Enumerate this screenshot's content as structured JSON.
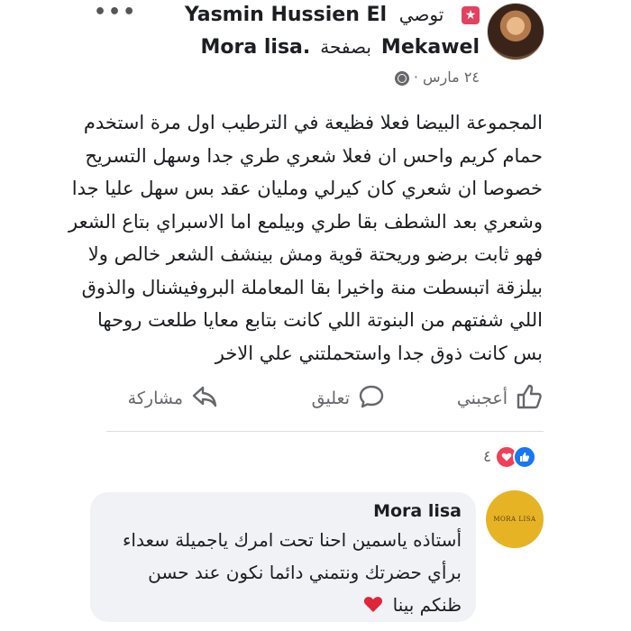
{
  "post": {
    "more_label": "•••",
    "author_name": "Yasmin Hussien El",
    "recommend_label": "توصي",
    "author_name_cont": "Mekawel",
    "page_preposition": "بصفحة",
    "page_name": "Mora lisa.",
    "date": "٢٤ مارس ·",
    "text_lines": [
      "المجموعة البيضا فعلا فظيعة في الترطيب اول مرة استخدم",
      "حمام كريم واحس ان فعلا شعري طري جدا وسهل التسريح",
      "خصوصا ان شعري كان كيرلي ومليان عقد بس سهل عليا جدا",
      "وشعري بعد الشطف بقا طري وبيلمع اما الاسبراي بتاع الشعر",
      "فهو ثابت برضو وريحتة قوية ومش بينشف الشعر خالص ولا",
      "بيلزقة اتبسطت منة واخيرا بقا المعاملة البروفيشنال والذوق",
      "اللي شفتهم من البنوتة اللي كانت بتابع معايا طلعت روحها",
      "بس كانت ذوق جدا واستحملتني علي الاخر"
    ]
  },
  "actions": {
    "like_label": "أعجبني",
    "comment_label": "تعليق",
    "share_label": "مشاركة"
  },
  "reactions": {
    "count": "٤",
    "icons": [
      "like-icon",
      "love-icon"
    ],
    "like_color": "#1877f2",
    "love_color": "#f33e58"
  },
  "comment": {
    "author": "Mora lisa",
    "avatar_text": "MORA LISA",
    "lines": [
      "أستاذه ياسمين احنا تحت امرك ياجميلة سعداء",
      "برأي حضرتك ونتمني دائما نكون عند حسن",
      "ظنكم بينا"
    ],
    "bubble_color": "#f0f2f5"
  }
}
